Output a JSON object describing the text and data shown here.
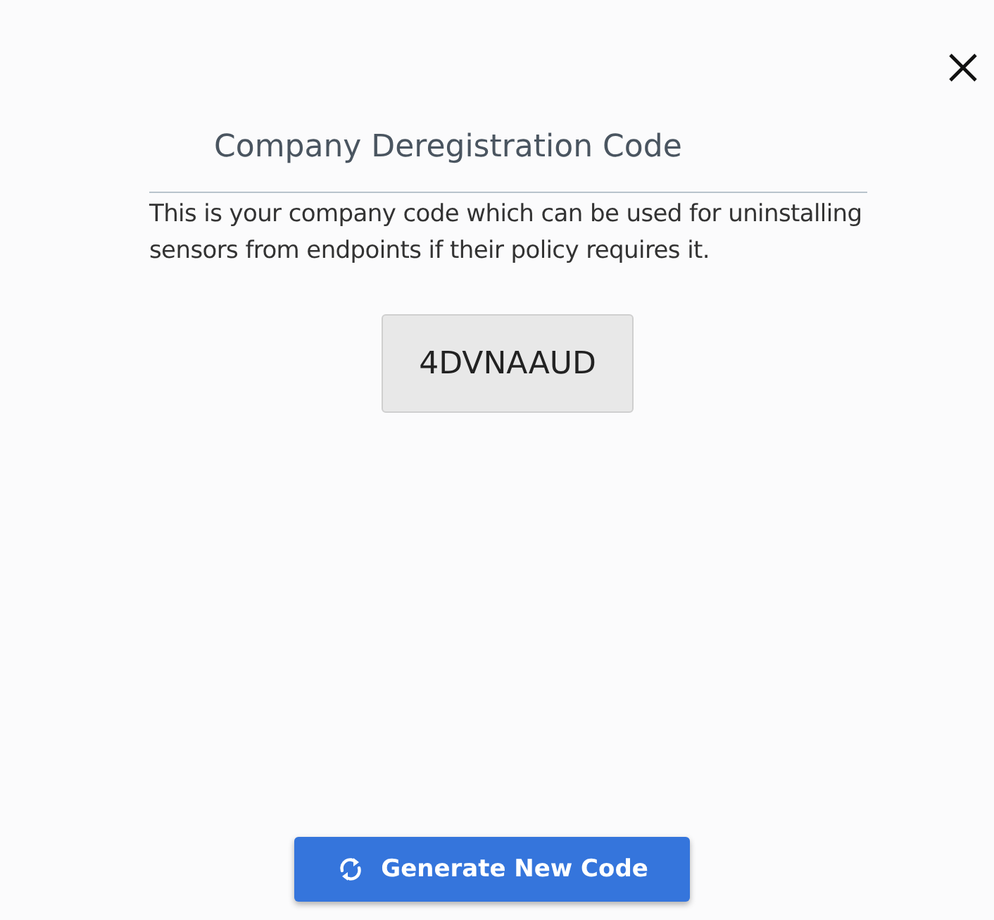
{
  "dialog": {
    "title": "Company Deregistration Code",
    "description": "This is your company code which can be used for uninstalling sensors from endpoints if their policy requires it.",
    "code": "4DVNAAUD",
    "button": "Generate New Code"
  }
}
